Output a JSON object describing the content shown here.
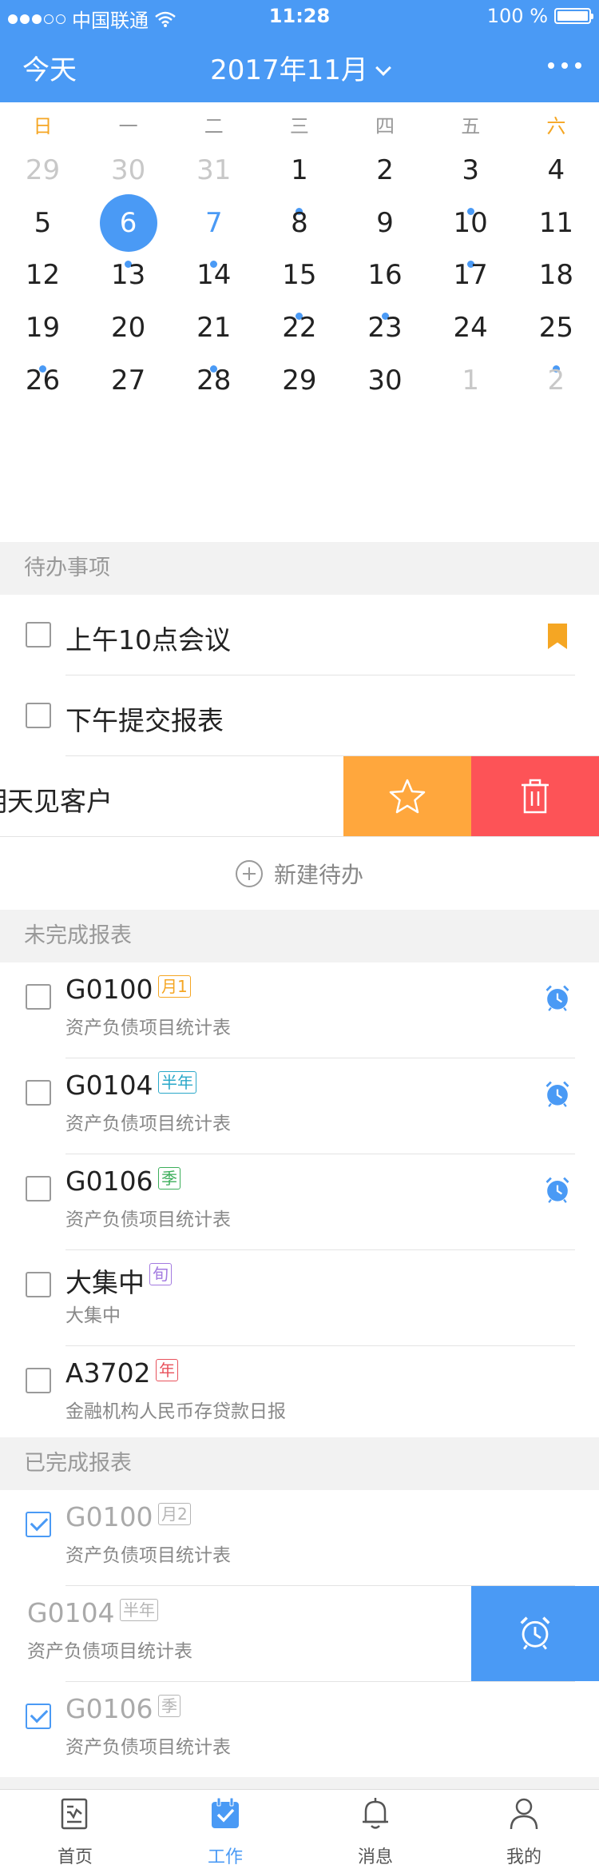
{
  "status_bar": {
    "carrier": "中国联通",
    "time": "11:28",
    "battery": "100 %"
  },
  "header": {
    "today_label": "今天",
    "month": "2017年11月"
  },
  "calendar": {
    "weekdays": [
      "日",
      "一",
      "二",
      "三",
      "四",
      "五",
      "六"
    ],
    "weeks": [
      [
        {
          "d": "29",
          "muted": true
        },
        {
          "d": "30",
          "muted": true
        },
        {
          "d": "31",
          "muted": true
        },
        {
          "d": "1",
          "dot": true
        },
        {
          "d": "2"
        },
        {
          "d": "3",
          "dot": true
        },
        {
          "d": "4"
        }
      ],
      [
        {
          "d": "5"
        },
        {
          "d": "6",
          "today": true,
          "dot": true
        },
        {
          "d": "7",
          "blue": true,
          "dot": true
        },
        {
          "d": "8"
        },
        {
          "d": "9"
        },
        {
          "d": "10",
          "dot": true
        },
        {
          "d": "11"
        }
      ],
      [
        {
          "d": "12"
        },
        {
          "d": "13"
        },
        {
          "d": "14"
        },
        {
          "d": "15",
          "dot": true
        },
        {
          "d": "16",
          "dot": true
        },
        {
          "d": "17"
        },
        {
          "d": "18"
        }
      ],
      [
        {
          "d": "19",
          "dot": true
        },
        {
          "d": "20"
        },
        {
          "d": "21",
          "dot": true
        },
        {
          "d": "22"
        },
        {
          "d": "23"
        },
        {
          "d": "24"
        },
        {
          "d": "25",
          "dot": true
        }
      ],
      [
        {
          "d": "26"
        },
        {
          "d": "27"
        },
        {
          "d": "28"
        },
        {
          "d": "29"
        },
        {
          "d": "30"
        },
        {
          "d": "1",
          "muted": true
        },
        {
          "d": "2",
          "muted": true
        }
      ]
    ],
    "colors": {
      "accent": "#4a9af5",
      "weekend": "#f5a623"
    }
  },
  "todos": {
    "title": "待办事项",
    "items": [
      "上午10点会议",
      "下午提交报表",
      "明天见客户"
    ],
    "new_label": "新建待办"
  },
  "pending": {
    "title": "未完成报表",
    "items": [
      {
        "code": "G0100",
        "tag": "月1",
        "sub": "资产负债项目统计表"
      },
      {
        "code": "G0104",
        "tag": "半年",
        "sub": "资产负债项目统计表"
      },
      {
        "code": "G0106",
        "tag": "季",
        "sub": "资产负债项目统计表"
      },
      {
        "code": "大集中",
        "tag": "旬",
        "sub": "大集中"
      },
      {
        "code": "A3702",
        "tag": "年",
        "sub": "金融机构人民币存贷款日报"
      }
    ]
  },
  "completed": {
    "title": "已完成报表",
    "items": [
      {
        "code": "G0100",
        "tag": "月2",
        "sub": "资产负债项目统计表"
      },
      {
        "code": "G0104",
        "tag": "半年",
        "sub": "资产负债项目统计表"
      },
      {
        "code": "G0106",
        "tag": "季",
        "sub": "资产负债项目统计表"
      }
    ]
  },
  "tabbar": [
    "首页",
    "工作",
    "消息",
    "我的"
  ]
}
